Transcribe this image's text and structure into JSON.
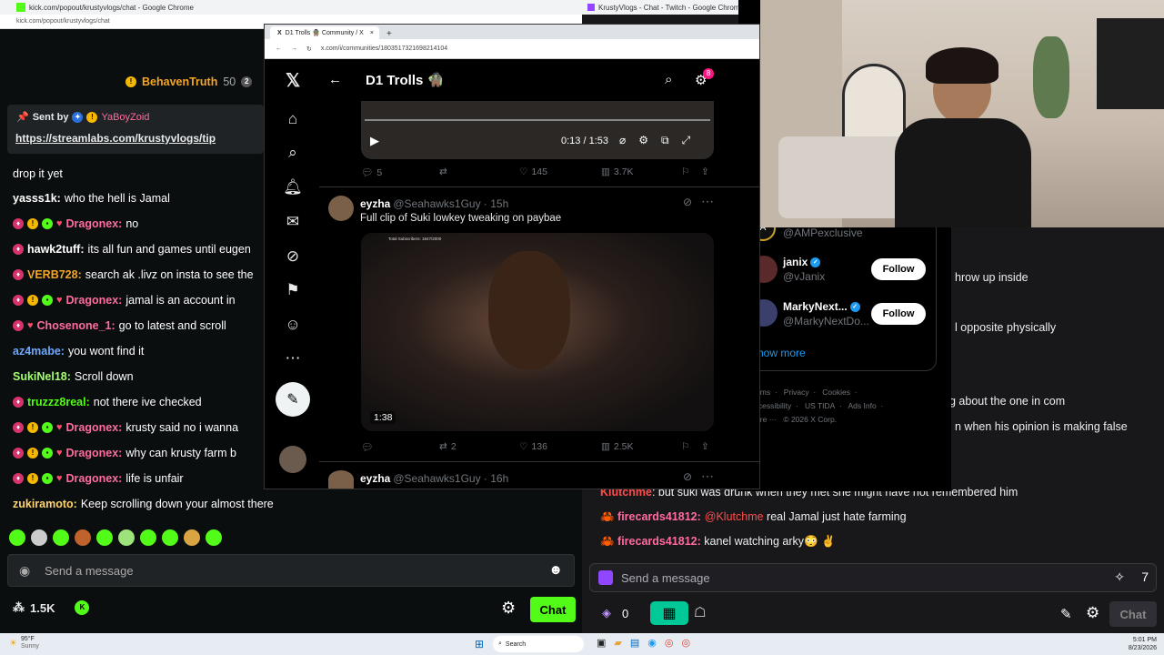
{
  "kick": {
    "window_title": "kick.com/popout/krustyvlogs/chat - Google Chrome",
    "url": "kick.com/popout/krustyvlogs/chat",
    "gift_user": "BehavenTruth",
    "gift_count": "50",
    "pinned": {
      "sent_by_label": "Sent by",
      "sent_by_user": "YaBoyZoid",
      "link": "https://streamlabs.com/krustyvlogs/tip"
    },
    "messages": [
      {
        "user": "",
        "text": "drop it yet",
        "color": "#ffffff"
      },
      {
        "user": "yasss1k:",
        "text": "who the hell is Jamal",
        "color": "#ffffff"
      },
      {
        "user": "Dragonex:",
        "text": "no",
        "color": "#ff6b9d"
      },
      {
        "user": "hawk2tuff:",
        "text": "its all fun and games until eugen",
        "color": "#ffffff"
      },
      {
        "user": "VERB728:",
        "text": "search ak .livz on insta to see the",
        "color": "#f5a623"
      },
      {
        "user": "Dragonex:",
        "text": "jamal is an account in",
        "color": "#ff6b9d"
      },
      {
        "user": "Chosenone_1:",
        "text": "go to latest and scroll",
        "color": "#ff6b9d"
      },
      {
        "user": "az4mabe:",
        "text": "you wont find it",
        "color": "#6ea8ff"
      },
      {
        "user": "SukiNel18:",
        "text": "Scroll down",
        "color": "#a3ff6e"
      },
      {
        "user": "truzzz8real:",
        "text": "not there ive checked",
        "color": "#53fc18"
      },
      {
        "user": "Dragonex:",
        "text": "krusty said no i wanna",
        "color": "#ff6b9d"
      },
      {
        "user": "Dragonex:",
        "text": "why can krusty farm b",
        "color": "#ff6b9d"
      },
      {
        "user": "Dragonex:",
        "text": "life is unfair",
        "color": "#ff6b9d"
      },
      {
        "user": "zukiramoto:",
        "text": "Keep scrolling down your almost there",
        "color": "#ffd36e"
      }
    ],
    "input_placeholder": "Send a message",
    "viewer_count": "1.5K",
    "chat_button": "Chat"
  },
  "x": {
    "tab_title": "D1 Trolls 🧌 Community / X",
    "url": "x.com/i/communities/1803517321698214104",
    "community_title": "D1 Trolls 🧌",
    "notif_count": "8",
    "video": {
      "time": "0:13 / 1:53"
    },
    "tweet1_actions": {
      "replies": "5",
      "likes": "145",
      "views": "3.7K"
    },
    "tweet2": {
      "name": "eyzha",
      "handle": "@Seahawks1Guy · 15h",
      "text": "Full clip of Suki lowkey tweaking on paybae",
      "duration": "1:38",
      "overlay": "Total Subscribers: 1847/2000",
      "retweets": "2",
      "likes": "136",
      "views": "2.5K"
    },
    "tweet3": {
      "name": "eyzha",
      "handle": "@Seahawks1Guy · 16h"
    },
    "suggestions": [
      {
        "name": "",
        "handle": "@AMPexclusive"
      },
      {
        "name": "janix",
        "handle": "@vJanix",
        "button": "Follow"
      },
      {
        "name": "MarkyNext...",
        "handle": "@MarkyNextDo...",
        "button": "Follow"
      }
    ],
    "show_more": "Show more",
    "footer": [
      "Terms",
      "Privacy",
      "Cookies",
      "Accessibility",
      "US TIDA",
      "Ads Info",
      "More ···",
      "© 2026 X Corp."
    ]
  },
  "twitch": {
    "window_title": "KrustyVlogs - Chat - Twitch - Google Chrome",
    "partial_lines": [
      "hrow up inside",
      "l opposite physically",
      "g about the one in com",
      "n when his opinion is making false"
    ],
    "messages": [
      {
        "user": "Klutchme",
        "text": ": but suki was drunk when they met she might have not remembered him",
        "color": "#ff4d4d"
      },
      {
        "user": "firecards41812:",
        "mention": "@Klutchme",
        "text": " real Jamal just hate farming",
        "color": "#ff6b9d"
      },
      {
        "user": "firecards41812:",
        "text": " kanel watching arky😳 ✌",
        "color": "#ff6b9d"
      }
    ],
    "input_placeholder": "Send a message",
    "points": "0",
    "chat_button": "Chat"
  },
  "taskbar": {
    "weather_temp": "95°F",
    "weather_desc": "Sunny",
    "search": "Search",
    "time": "5:01 PM",
    "date": "8/23/2026"
  }
}
